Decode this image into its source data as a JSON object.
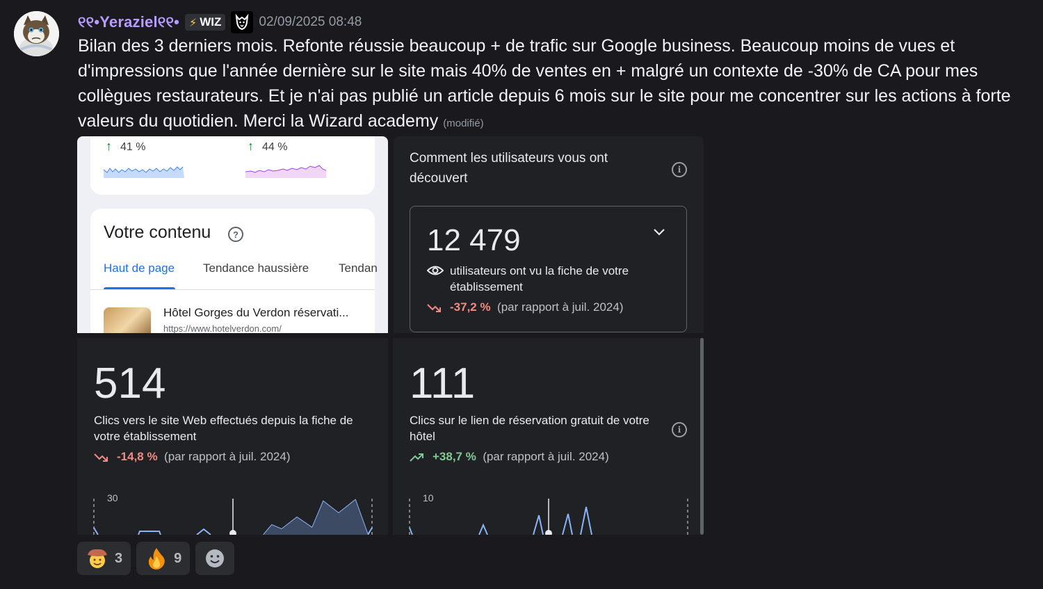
{
  "message": {
    "username": "୧୧•Yeraziel୧୧•",
    "tag": "WIZ",
    "timestamp": "02/09/2025 08:48",
    "text": "Bilan des 3 derniers mois. Refonte réussie beaucoup + de trafic sur Google business. Beaucoup moins de vues et d'impressions que l'année dernière sur le site mais 40% de ventes en + malgré un contexte de -30% de CA pour mes collègues restaurateurs. Et je n'ai pas publié un article depuis 6 mois sur le site pour me concentrer sur les actions à forte valeurs du quotidien. Merci la Wizard academy",
    "edited": "(modifié)"
  },
  "screenshot_left": {
    "stat1": "41 %",
    "stat2": "44 %",
    "content_title": "Votre contenu",
    "tabs": [
      "Haut de page",
      "Tendance haussière",
      "Tendan"
    ],
    "item_title": "Hôtel Gorges du Verdon réservati...",
    "item_url": "https://www.hotelverdon.com/"
  },
  "discovery": {
    "title": "Comment les utilisateurs vous ont découvert",
    "value": "12 479",
    "desc": "utilisateurs ont vu la fiche de votre établissement",
    "delta": "-37,2 %",
    "comparison": "(par rapport à juil. 2024)"
  },
  "website_clicks": {
    "value": "514",
    "desc": "Clics vers le site Web effectués depuis la fiche de votre établissement",
    "delta": "-14,8 %",
    "comparison": "(par rapport à juil. 2024)",
    "axis_max": "30"
  },
  "booking_clicks": {
    "value": "111",
    "desc": "Clics sur le lien de réservation gratuit de votre hôtel",
    "delta": "+38,7 %",
    "comparison": "(par rapport à juil. 2024)",
    "axis_max": "10"
  },
  "reactions": [
    {
      "icon": "cowboy-face-emoji",
      "count": "3"
    },
    {
      "icon": "fire-emoji",
      "count": "9"
    },
    {
      "icon": "add-reaction-icon",
      "count": ""
    }
  ],
  "colors": {
    "background": "#1a1a1e",
    "username": "#b89bff",
    "negative": "#f28b82",
    "positive": "#81c995",
    "google_blue": "#1a73e8"
  }
}
